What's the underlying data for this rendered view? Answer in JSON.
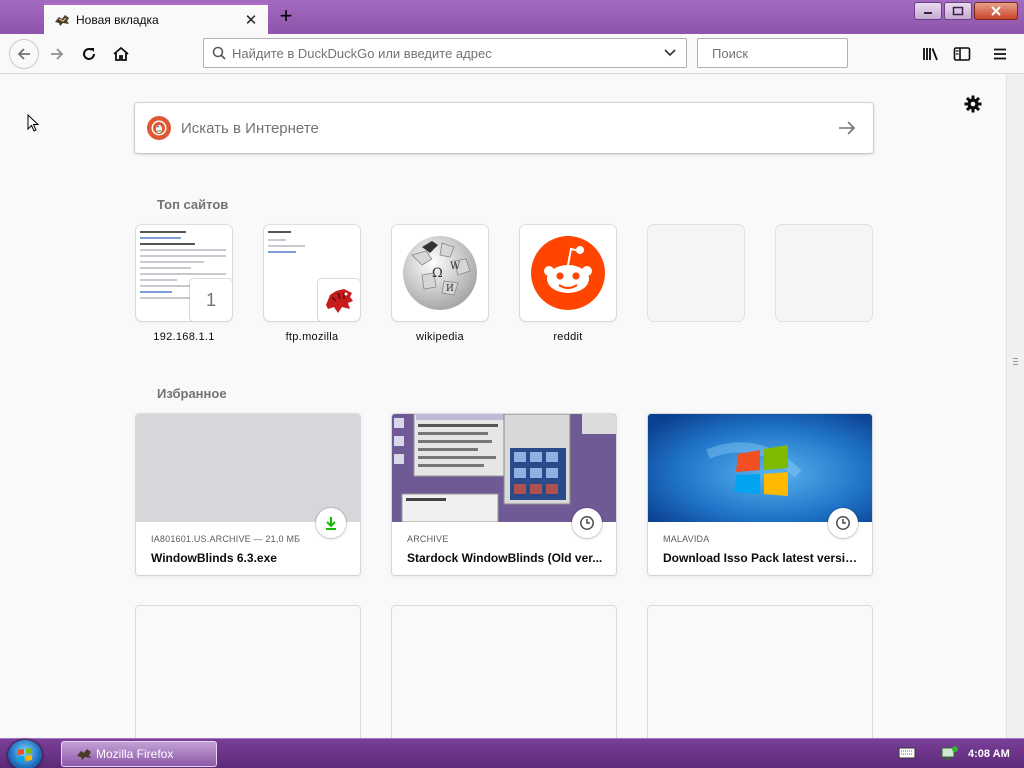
{
  "tab": {
    "title": "Новая вкладка"
  },
  "toolbar": {
    "url_placeholder": "Найдите в DuckDuckGo или введите адрес",
    "search_placeholder": "Поиск"
  },
  "newtab": {
    "search_placeholder": "Искать в Интернете",
    "top_sites_title": "Топ сайтов",
    "highlights_title": "Избранное",
    "top_sites": [
      {
        "label": "192.168.1.1",
        "badge": "1"
      },
      {
        "label": "ftp.mozilla"
      },
      {
        "label": "wikipedia"
      },
      {
        "label": "reddit"
      },
      {
        "label": ""
      },
      {
        "label": ""
      }
    ],
    "highlights": [
      {
        "source": "IA801601.US.ARCHIVE — 21,0 МБ",
        "title": "WindowBlinds 6.3.exe",
        "action_icon": "download-icon"
      },
      {
        "source": "ARCHIVE",
        "title": "Stardock WindowBlinds (Old ver...",
        "action_icon": "clock-icon"
      },
      {
        "source": "MALAVIDA",
        "title": "Download Isso Pack latest versio...",
        "action_icon": "clock-icon"
      }
    ]
  },
  "taskbar": {
    "task_label": "Mozilla Firefox",
    "clock": "4:08 AM"
  },
  "colors": {
    "theme_purple": "#8d54aa",
    "ddg_orange": "#de5833",
    "reddit_orange": "#ff4500",
    "download_green": "#12bc00"
  }
}
